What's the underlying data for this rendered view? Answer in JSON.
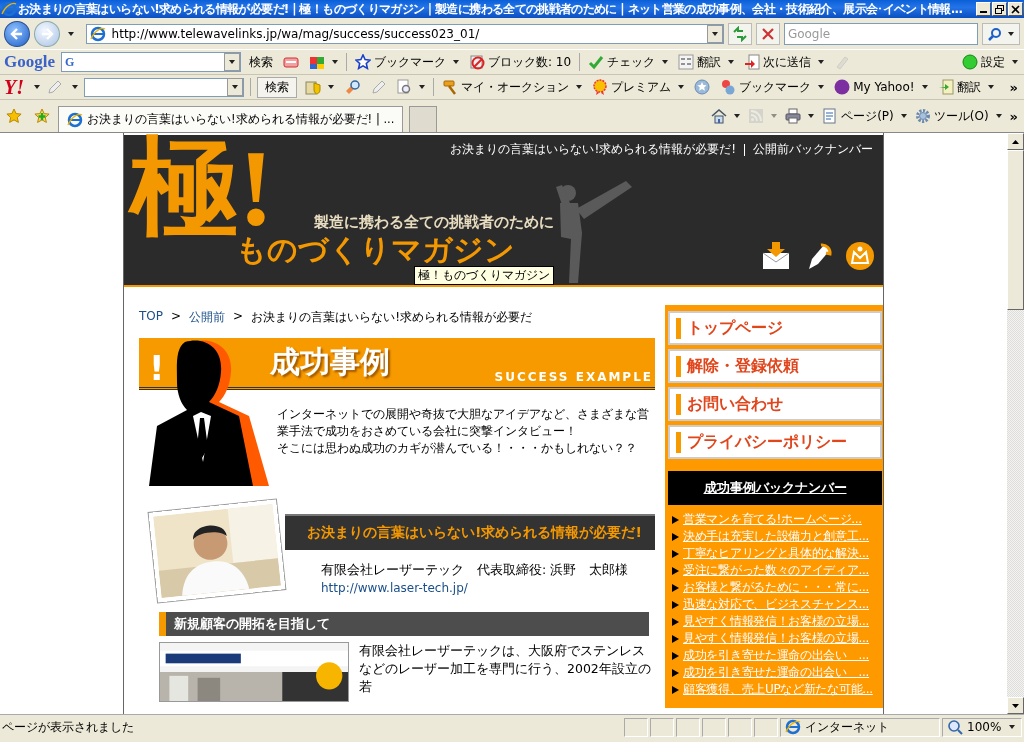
{
  "window": {
    "title": "お決まりの言葉はいらない!求められる情報が必要だ! | 極！ものづくりマガジン | 製造に携わる全ての挑戦者のために | ネット営業の成功事例、会社・技術紹介、展示会･イベント情報..."
  },
  "nav": {
    "url": "http://www.telewavelinks.jp/wa/mag/success/success023_01/",
    "search_placeholder": "Google"
  },
  "google_toolbar": {
    "logo": "Google",
    "field_icon": "G",
    "search_label": "検索",
    "items": [
      {
        "kind": "card",
        "caret": false,
        "disabled": false
      },
      {
        "kind": "puzzle",
        "caret": true,
        "disabled": false
      },
      {
        "kind": "star",
        "label": "ブックマーク",
        "caret": true,
        "disabled": false
      },
      {
        "kind": "block",
        "label": "ブロック数: 10",
        "caret": false,
        "disabled": false
      },
      {
        "kind": "check",
        "label": "チェック",
        "caret": true,
        "disabled": false
      },
      {
        "kind": "translate",
        "label": "翻訳",
        "caret": true,
        "disabled": false
      },
      {
        "kind": "send",
        "label": "次に送信",
        "caret": true,
        "disabled": false
      },
      {
        "kind": "eraser",
        "caret": false,
        "disabled": true
      }
    ],
    "settings": {
      "label": "設定"
    }
  },
  "yahoo_toolbar": {
    "logo": "Y!",
    "search_label": "検索",
    "items": [
      {
        "kind": "shield",
        "caret": true
      },
      {
        "kind": "magnifier",
        "caret": false
      },
      {
        "kind": "pen",
        "caret": false
      },
      {
        "kind": "zoomdoc",
        "caret": true
      },
      {
        "kind": "hammer",
        "label": "マイ・オークション",
        "caret": true
      },
      {
        "kind": "ribbon",
        "label": "プレミアム",
        "caret": true
      },
      {
        "kind": "starcircle",
        "caret": false
      },
      {
        "kind": "pin",
        "label": "ブックマーク",
        "caret": true
      },
      {
        "kind": "mycircle",
        "label": "My Yahoo!",
        "caret": true
      },
      {
        "kind": "pagearrow",
        "label": "翻訳",
        "caret": true
      }
    ],
    "more": "»"
  },
  "tabs": [
    {
      "title": "お決まりの言葉はいらない!求められる情報が必要だ! | ...",
      "selected": true
    },
    {
      "selected": false
    }
  ],
  "command_bar": {
    "items": [
      {
        "kind": "home",
        "caret": true,
        "disabled": false
      },
      {
        "kind": "feed",
        "caret": true,
        "disabled": true
      },
      {
        "kind": "printer",
        "caret": true,
        "disabled": false
      },
      {
        "kind": "page",
        "label": "ページ(P)",
        "caret": true,
        "disabled": false
      },
      {
        "kind": "gear",
        "label": "ツール(O)",
        "caret": true,
        "disabled": false
      }
    ],
    "more": "»"
  },
  "header": {
    "links": [
      "お決まりの言葉はいらない!求められる情報が必要だ!",
      "公開前バックナンバー"
    ],
    "logo_mark": "極!",
    "logo_title": "ものづくりマガジン",
    "tagline": "製造に携わる全ての挑戦者のために",
    "tooltip": "極！ものづくりマガジン"
  },
  "breadcrumb": {
    "separator": ">",
    "items": [
      {
        "label": "TOP",
        "link": true
      },
      {
        "label": "公開前",
        "link": true
      },
      {
        "label": "お決まりの言葉はいらない!求められる情報が必要だ",
        "link": false
      }
    ]
  },
  "section": {
    "mark": "!",
    "title": "成功事例",
    "subtitle": "SUCCESS EXAMPLE",
    "intro": [
      "インターネットでの展開や奇抜で大胆なアイデアなど、さまざまな営業手法で成功をおさめている会社に突撃インタビュー！",
      "そこには思わぬ成功のカギが潜んでいる！・・・かもしれない？？"
    ]
  },
  "interview": {
    "headline": "お決まりの言葉はいらない!求められる情報が必要だ!",
    "company": "有限会社レーザーテック　代表取締役: 浜野　太郎様",
    "url": "http://www.laser-tech.jp/"
  },
  "article": {
    "heading": "新規顧客の開拓を目指して",
    "text": "有限会社レーザーテックは、大阪府でステンレスなどのレーザー加工を専門に行う、2002年設立の若"
  },
  "sidebar": {
    "nav": [
      "トップページ",
      "解除・登録依頼",
      "お問い合わせ",
      "プライバシーポリシー"
    ],
    "backnumber_title": "成功事例バックナンバー",
    "backnumbers": [
      "営業マンを育てる!ホームページ...",
      "決め手は充実した設備力と創意工...",
      "丁寧なヒアリングと具体的な解決...",
      "受注に繋がった数々のアイディア...",
      "お客様と繋がるために・・・常に...",
      "迅速な対応で、ビジネスチャンス...",
      "見やすく情報発信！お客様の立場...",
      "見やすく情報発信！お客様の立場...",
      "成功を引き寄せた運命の出会い　...",
      "成功を引き寄せた運命の出会い　...",
      "顧客獲得、売上UPなど新たな可能..."
    ]
  },
  "status_bar": {
    "text": "ページが表示されました",
    "zone": "インターネット",
    "zoom": "100%"
  }
}
